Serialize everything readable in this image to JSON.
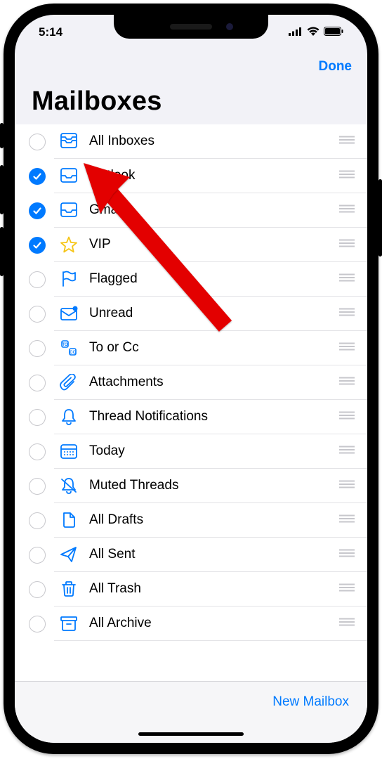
{
  "statusbar": {
    "time": "5:14"
  },
  "nav": {
    "done_label": "Done"
  },
  "title": "Mailboxes",
  "toolbar": {
    "new_mailbox_label": "New Mailbox"
  },
  "colors": {
    "accent": "#007aff"
  },
  "mailboxes": [
    {
      "label": "All Inboxes",
      "checked": false,
      "icon": "all-inboxes-icon"
    },
    {
      "label": "Outlook",
      "checked": true,
      "icon": "inbox-icon"
    },
    {
      "label": "Gmail",
      "checked": true,
      "icon": "inbox-icon"
    },
    {
      "label": "VIP",
      "checked": true,
      "icon": "star-icon"
    },
    {
      "label": "Flagged",
      "checked": false,
      "icon": "flag-icon"
    },
    {
      "label": "Unread",
      "checked": false,
      "icon": "unread-icon"
    },
    {
      "label": "To or Cc",
      "checked": false,
      "icon": "tocc-icon"
    },
    {
      "label": "Attachments",
      "checked": false,
      "icon": "paperclip-icon"
    },
    {
      "label": "Thread Notifications",
      "checked": false,
      "icon": "bell-icon"
    },
    {
      "label": "Today",
      "checked": false,
      "icon": "calendar-icon"
    },
    {
      "label": "Muted Threads",
      "checked": false,
      "icon": "bell-slash-icon"
    },
    {
      "label": "All Drafts",
      "checked": false,
      "icon": "document-icon"
    },
    {
      "label": "All Sent",
      "checked": false,
      "icon": "paperplane-icon"
    },
    {
      "label": "All Trash",
      "checked": false,
      "icon": "trash-icon"
    },
    {
      "label": "All Archive",
      "checked": false,
      "icon": "archivebox-icon"
    }
  ]
}
